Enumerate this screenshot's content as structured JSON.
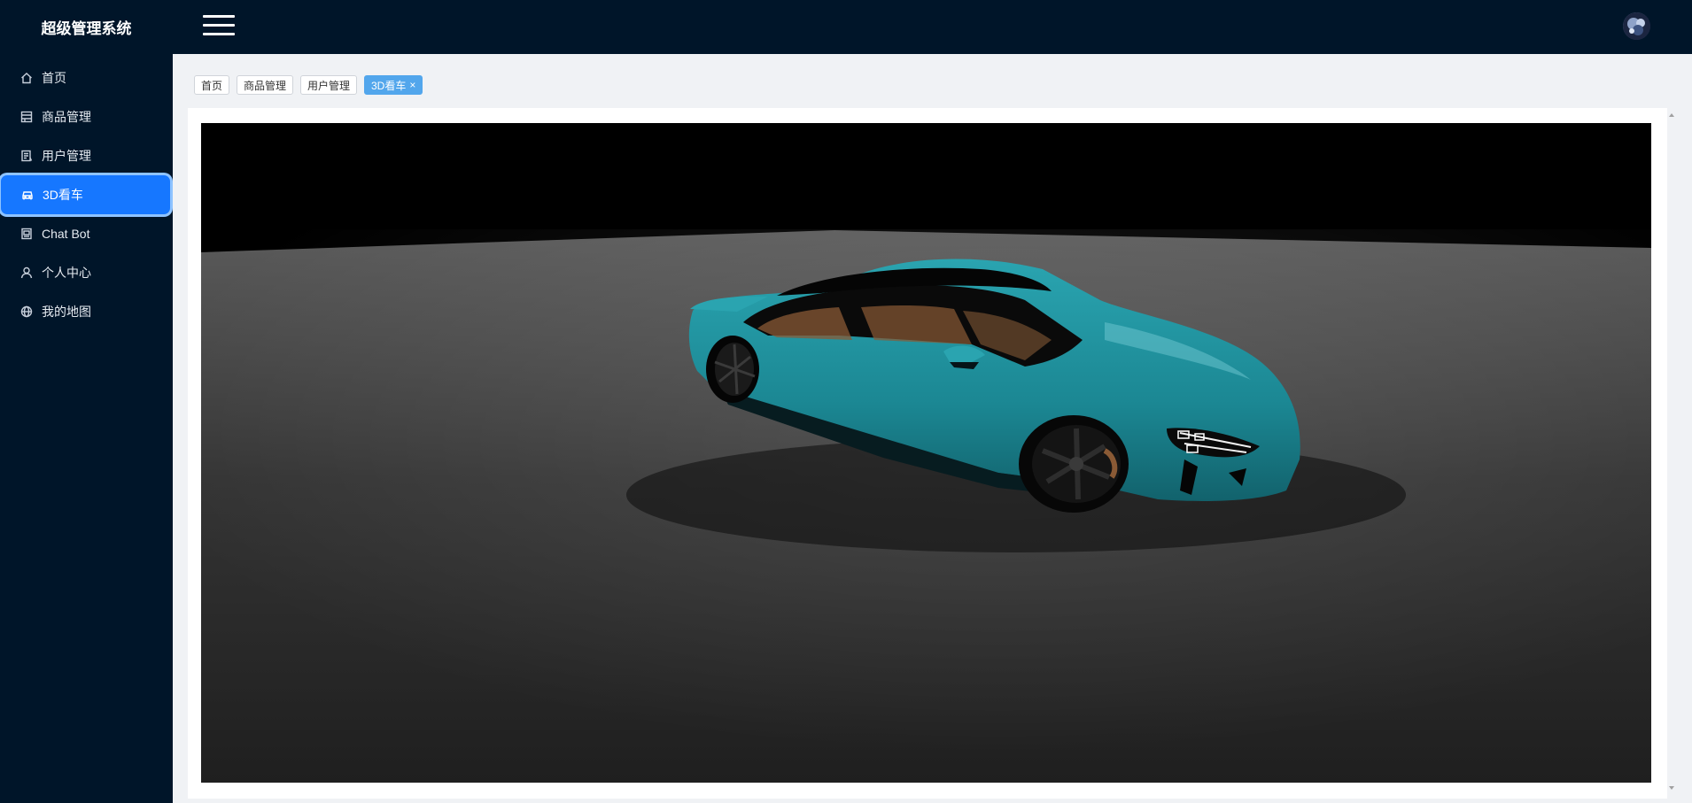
{
  "app": {
    "title": "超级管理系统"
  },
  "header": {
    "menu_toggle_icon": "hamburger-icon",
    "avatar_icon": "avatar"
  },
  "sidebar": {
    "items": [
      {
        "label": "首页",
        "icon": "home-icon"
      },
      {
        "label": "商品管理",
        "icon": "box-icon"
      },
      {
        "label": "用户管理",
        "icon": "user-list-icon"
      },
      {
        "label": "3D看车",
        "icon": "car-icon",
        "active": true
      },
      {
        "label": "Chat Bot",
        "icon": "bot-icon"
      },
      {
        "label": "个人中心",
        "icon": "user-icon"
      },
      {
        "label": "我的地图",
        "icon": "globe-icon"
      }
    ]
  },
  "tabs": [
    {
      "label": "首页"
    },
    {
      "label": "商品管理"
    },
    {
      "label": "用户管理"
    },
    {
      "label": "3D看车",
      "active": true,
      "close": "×"
    }
  ],
  "viewer": {
    "car_color": "#1f8f9c",
    "floor_color": "#3a3a3a",
    "background": "#000000"
  },
  "colors": {
    "sidebar_bg": "#001529",
    "accent": "#1677ff",
    "tab_active": "#52a6ec"
  }
}
